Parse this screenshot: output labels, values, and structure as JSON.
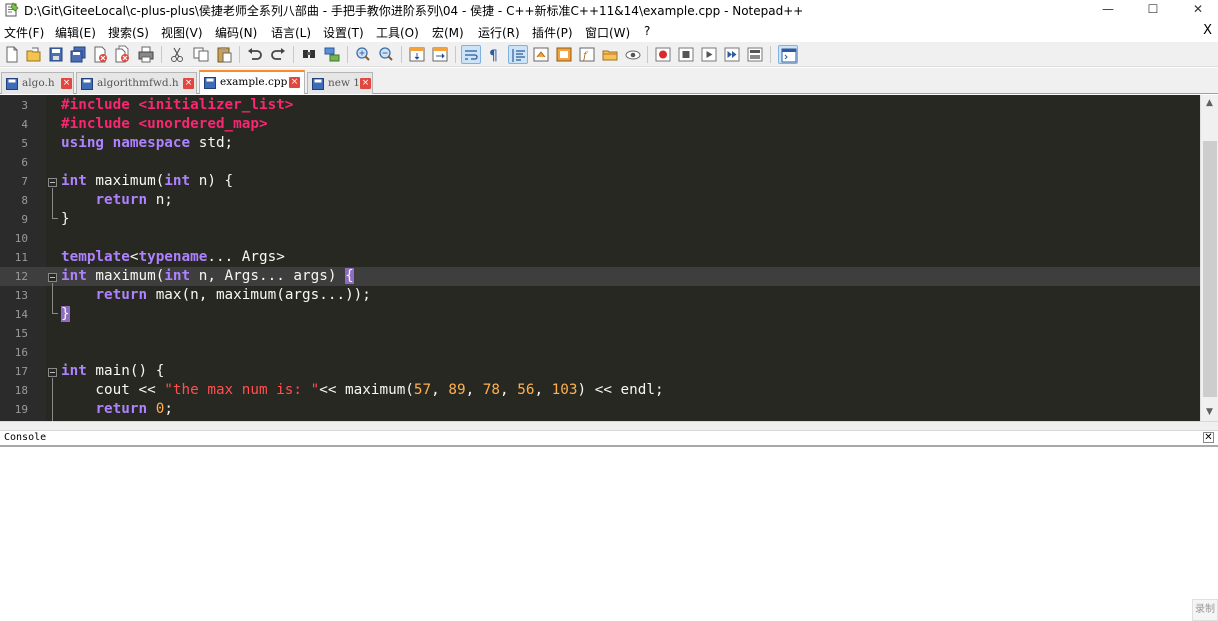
{
  "window": {
    "title": "D:\\Git\\GiteeLocal\\c-plus-plus\\侯捷老师全系列八部曲 - 手把手教你进阶系列\\04 - 侯捷 - C++新标准C++11&14\\example.cpp - Notepad++",
    "controls": {
      "minimize": "—",
      "maximize": "☐",
      "close": "✕"
    }
  },
  "menu": {
    "items": [
      "文件(F)",
      "编辑(E)",
      "搜索(S)",
      "视图(V)",
      "编码(N)",
      "语言(L)",
      "设置(T)",
      "工具(O)",
      "宏(M)",
      "运行(R)",
      "插件(P)",
      "窗口(W)",
      "?"
    ],
    "close_label": "X"
  },
  "toolbar": {
    "buttons": [
      "new-file",
      "open-file",
      "save",
      "save-all",
      "close",
      "close-all",
      "print",
      "cut",
      "copy",
      "paste",
      "undo",
      "redo",
      "find",
      "replace",
      "zoom-in",
      "zoom-out",
      "sync-vertical",
      "sync-horizontal",
      "word-wrap",
      "show-all-chars",
      "indent-guide",
      "language-udl",
      "doc-map",
      "function-list",
      "folder-workspace",
      "monitoring",
      "record-macro",
      "stop-record",
      "playback-macro",
      "run-macro-multiple",
      "save-macro",
      "monitor-console"
    ]
  },
  "tabs": [
    {
      "label": "algo.h",
      "active": false
    },
    {
      "label": "algorithmfwd.h",
      "active": false
    },
    {
      "label": "example.cpp",
      "active": true
    },
    {
      "label": "new 1",
      "active": false
    }
  ],
  "editor": {
    "current_line": 12,
    "lines": [
      {
        "n": "3"
      },
      {
        "n": "4"
      },
      {
        "n": "5"
      },
      {
        "n": "6"
      },
      {
        "n": "7"
      },
      {
        "n": "8"
      },
      {
        "n": "9"
      },
      {
        "n": "10"
      },
      {
        "n": "11"
      },
      {
        "n": "12"
      },
      {
        "n": "13"
      },
      {
        "n": "14"
      },
      {
        "n": "15"
      },
      {
        "n": "16"
      },
      {
        "n": "17"
      },
      {
        "n": "18"
      },
      {
        "n": "19"
      }
    ],
    "tokens": {
      "l3": [
        "#include",
        " ",
        "<initializer_list>"
      ],
      "l4": [
        "#include",
        " ",
        "<unordered_map>"
      ],
      "l5": [
        "using",
        " ",
        "namespace",
        " std;"
      ],
      "l7": [
        "int",
        " maximum(",
        "int",
        " n) {"
      ],
      "l8": [
        "    ",
        "return",
        " n;"
      ],
      "l9": [
        "}"
      ],
      "l11": [
        "template",
        "<",
        "typename",
        "... Args>"
      ],
      "l12": [
        "int",
        " maximum(",
        "int",
        " n, Args... args) ",
        "{"
      ],
      "l13": [
        "    ",
        "return",
        " max(n, maximum(args...));"
      ],
      "l14": [
        "}"
      ],
      "l17": [
        "int",
        " main() {"
      ],
      "l18": [
        "    cout << ",
        "\"the max num is: \"",
        "<< maximum(",
        "57",
        ", ",
        "89",
        ", ",
        "78",
        ", ",
        "56",
        ", ",
        "103",
        ") << endl;"
      ],
      "l19": [
        "    ",
        "return",
        " ",
        "0",
        ";"
      ]
    }
  },
  "console": {
    "title": "Console",
    "close_label": "✕"
  },
  "overlay": {
    "record_badge": "录制"
  },
  "colors": {
    "editor_bg": "#272822",
    "preprocessor": "#f92672",
    "keyword": "#66d9ef",
    "type_keyword": "#ae81ff",
    "string": "#ff4f4f",
    "number": "#ffb04f",
    "tab_active_accent": "#fa8a2a",
    "tab_close": "#e0483f"
  }
}
